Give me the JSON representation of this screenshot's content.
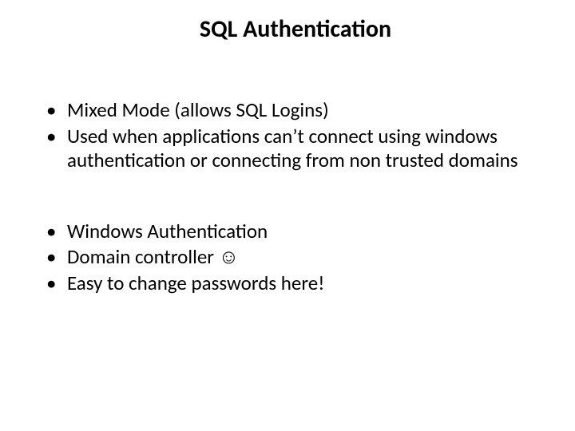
{
  "title": "SQL Authentication",
  "group1": {
    "items": [
      "Mixed Mode (allows SQL Logins)",
      "Used when applications can’t connect using windows authentication or connecting from non trusted domains"
    ]
  },
  "group2": {
    "items": [
      "Windows Authentication",
      "Domain controller ☺",
      "Easy to change passwords here!"
    ]
  }
}
